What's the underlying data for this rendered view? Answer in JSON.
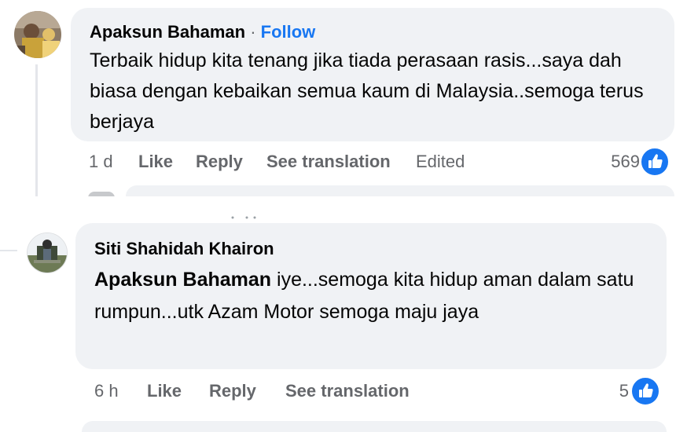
{
  "comment1": {
    "author": "Apaksun Bahaman",
    "separator": "·",
    "follow_label": "Follow",
    "text": "Terbaik hidup kita tenang jika tiada perasaan rasis...saya dah biasa dengan kebaikan semua kaum di Malaysia..semoga terus berjaya",
    "time": "1 d",
    "like_label": "Like",
    "reply_label": "Reply",
    "translate_label": "See translation",
    "edited_label": "Edited",
    "reaction_count": "569",
    "reaction_icon": "thumbs-up-icon"
  },
  "comment2": {
    "author": "Siti Shahidah Khairon",
    "mention": "Apaksun Bahaman",
    "text": " iye...semoga kita hidup aman dalam satu rumpun...utk Azam Motor semoga maju jaya",
    "time": "6 h",
    "like_label": "Like",
    "reply_label": "Reply",
    "translate_label": "See translation",
    "reaction_count": "5",
    "reaction_icon": "thumbs-up-icon"
  },
  "colors": {
    "bubble": "#f0f2f5",
    "link": "#1877f2",
    "secondary_text": "#65676b",
    "thread_line": "#e4e6eb"
  }
}
